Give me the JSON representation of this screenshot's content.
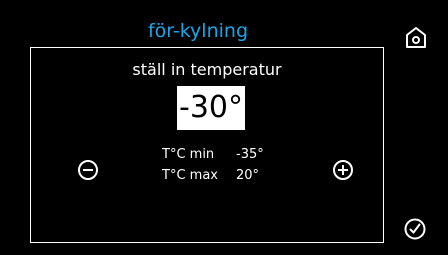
{
  "header": {
    "title": "för-kylning"
  },
  "panel": {
    "subtitle": "ställ in temperatur",
    "value": "-30°",
    "limits": [
      {
        "label": "T°C min",
        "value": "-35°"
      },
      {
        "label": "T°C max",
        "value": "20°"
      }
    ]
  },
  "icons": {
    "home": "home-icon",
    "decrease": "minus-circle-icon",
    "increase": "plus-circle-icon",
    "confirm": "check-circle-icon"
  },
  "colors": {
    "background": "#000000",
    "title": "#1aa6e6",
    "foreground": "#ffffff"
  }
}
